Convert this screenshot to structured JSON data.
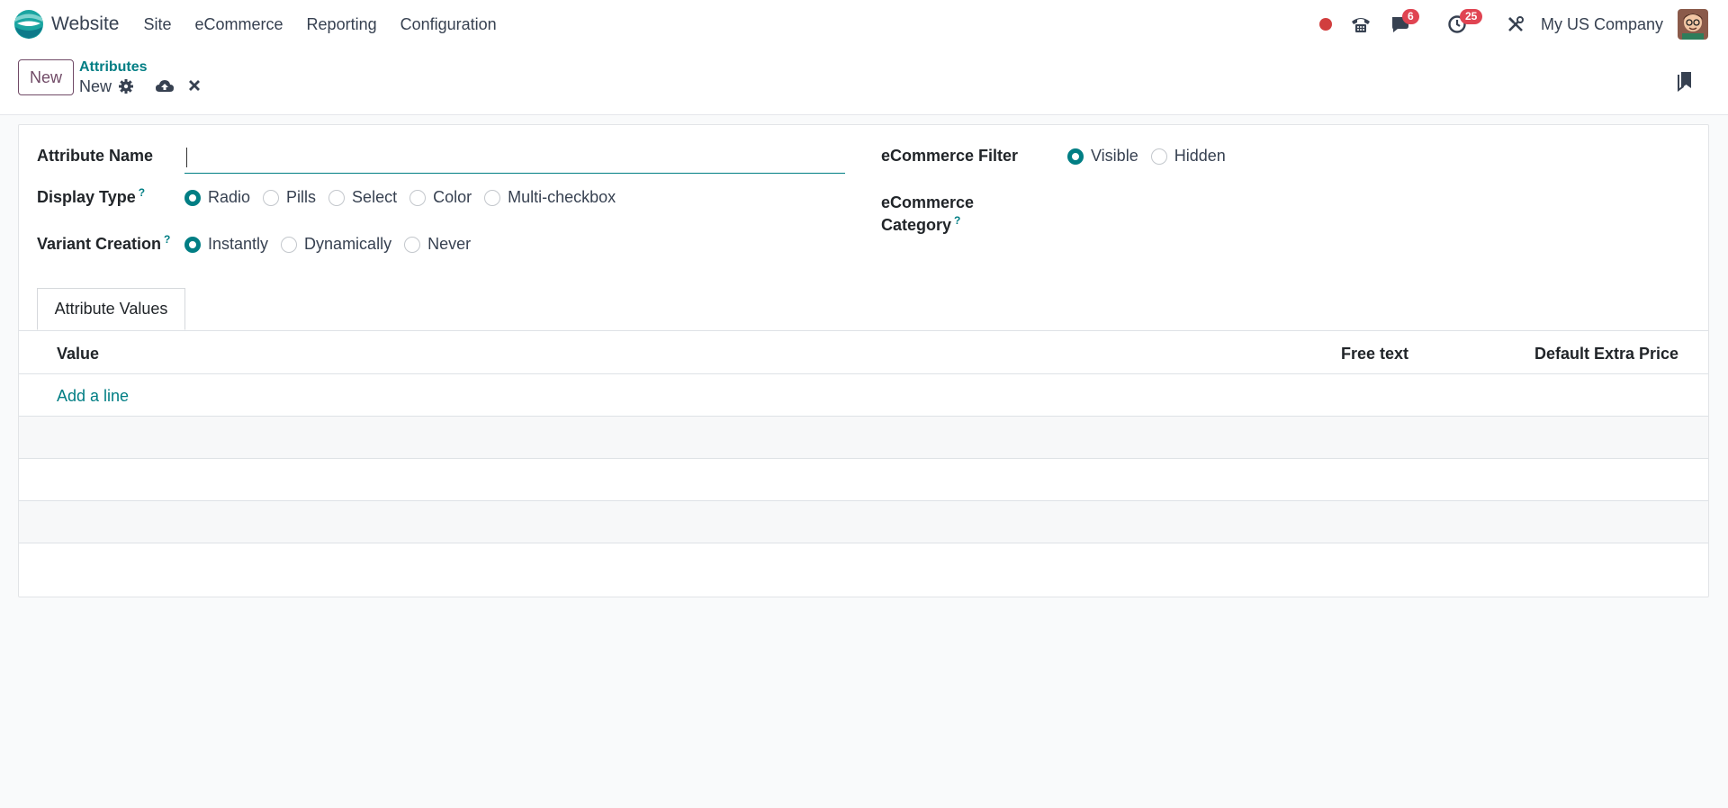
{
  "app": {
    "name": "Website",
    "menu": [
      "Site",
      "eCommerce",
      "Reporting",
      "Configuration"
    ],
    "company": "My US Company",
    "messages_count": "6",
    "activities_count": "25"
  },
  "control": {
    "new_button": "New",
    "breadcrumb": "Attributes",
    "record_title": "New"
  },
  "form": {
    "attribute_name_label": "Attribute Name",
    "attribute_name_value": "",
    "display_type_label": "Display Type",
    "display_type_options": [
      "Radio",
      "Pills",
      "Select",
      "Color",
      "Multi-checkbox"
    ],
    "display_type_selected": "Radio",
    "variant_creation_label": "Variant Creation",
    "variant_creation_options": [
      "Instantly",
      "Dynamically",
      "Never"
    ],
    "variant_creation_selected": "Instantly",
    "ecommerce_filter_label": "eCommerce Filter",
    "ecommerce_filter_options": [
      "Visible",
      "Hidden"
    ],
    "ecommerce_filter_selected": "Visible",
    "ecommerce_category_label_1": "eCommerce",
    "ecommerce_category_label_2": "Category",
    "help_mark": "?"
  },
  "tabs": {
    "attribute_values": "Attribute Values"
  },
  "table": {
    "columns": [
      "Value",
      "Free text",
      "Default Extra Price"
    ],
    "add_line": "Add a line"
  },
  "colors": {
    "primary": "#714b67",
    "accent": "#017e84",
    "badge": "#e04452"
  }
}
